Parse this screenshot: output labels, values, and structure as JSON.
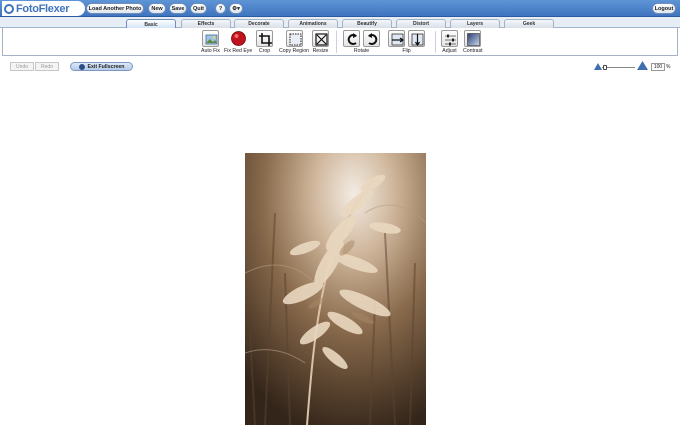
{
  "app": {
    "logo_text": "FotoFlexer",
    "brand_color": "#3f74bf"
  },
  "header": {
    "load_photo": "Load Another Photo",
    "new": "New",
    "save": "Save",
    "quit": "Quit",
    "help": "?",
    "settings": "⚙▾",
    "logout": "Logout"
  },
  "tabs": [
    "Basic",
    "Effects",
    "Decorate",
    "Animations",
    "Beautify",
    "Distort",
    "Layers",
    "Geek"
  ],
  "tools": [
    {
      "label": "Auto Fix",
      "icon": "auto-fix-icon"
    },
    {
      "label": "Fix Red Eye",
      "icon": "red-eye-icon"
    },
    {
      "label": "Crop",
      "icon": "crop-icon"
    },
    {
      "label": "Copy Region",
      "icon": "copy-region-icon"
    },
    {
      "label": "Resize",
      "icon": "resize-icon"
    },
    {
      "label": "Rotate",
      "icon": "rotate-icon"
    },
    {
      "label": "Flip",
      "icon": "flip-icon"
    },
    {
      "label": "Adjust",
      "icon": "adjust-icon"
    },
    {
      "label": "Contrast",
      "icon": "contrast-icon"
    }
  ],
  "history": {
    "undo": "Undo",
    "redo": "Redo"
  },
  "exit_fullscreen": "Exit Fullscreen",
  "zoom": {
    "value": "100",
    "unit": "%"
  }
}
